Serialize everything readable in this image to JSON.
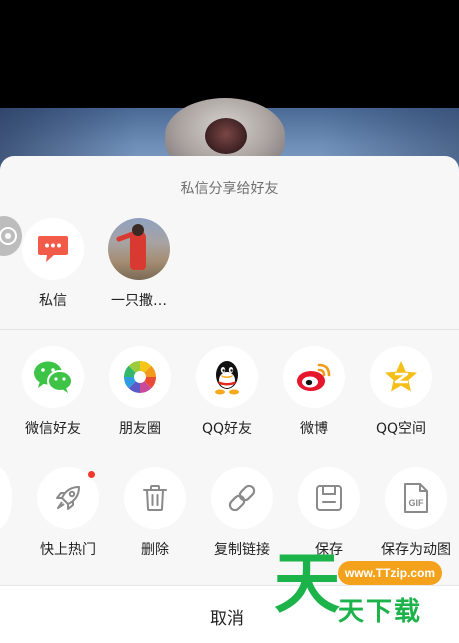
{
  "sheet": {
    "title": "私信分享给好友"
  },
  "friends": [
    {
      "label": "私信",
      "icon": "message-bubble-icon"
    },
    {
      "label": "一只撒…",
      "icon": "friend-avatar"
    }
  ],
  "share_targets": [
    {
      "label": "微信好友",
      "icon": "wechat-icon"
    },
    {
      "label": "朋友圈",
      "icon": "moments-icon"
    },
    {
      "label": "QQ好友",
      "icon": "qq-icon"
    },
    {
      "label": "微博",
      "icon": "weibo-icon"
    },
    {
      "label": "QQ空间",
      "icon": "qzone-icon"
    }
  ],
  "actions": [
    {
      "label": "快上热门",
      "icon": "rocket-icon",
      "badge": true
    },
    {
      "label": "删除",
      "icon": "trash-icon"
    },
    {
      "label": "复制链接",
      "icon": "link-icon"
    },
    {
      "label": "保存",
      "icon": "save-icon"
    },
    {
      "label": "保存为动图",
      "icon": "gif-icon"
    }
  ],
  "cancel": {
    "label": "取消"
  },
  "watermark": {
    "char": "天",
    "url": "www.TTzip.com",
    "text": "天下载"
  },
  "colors": {
    "sheet_bg": "#f7f7f7",
    "wechat": "#3dc446",
    "weibo": "#e6162d",
    "qzone": "#f5bf1a",
    "badge": "#f03a2a",
    "watermark_green": "#1bb34a",
    "watermark_orange": "#f4a21c"
  }
}
